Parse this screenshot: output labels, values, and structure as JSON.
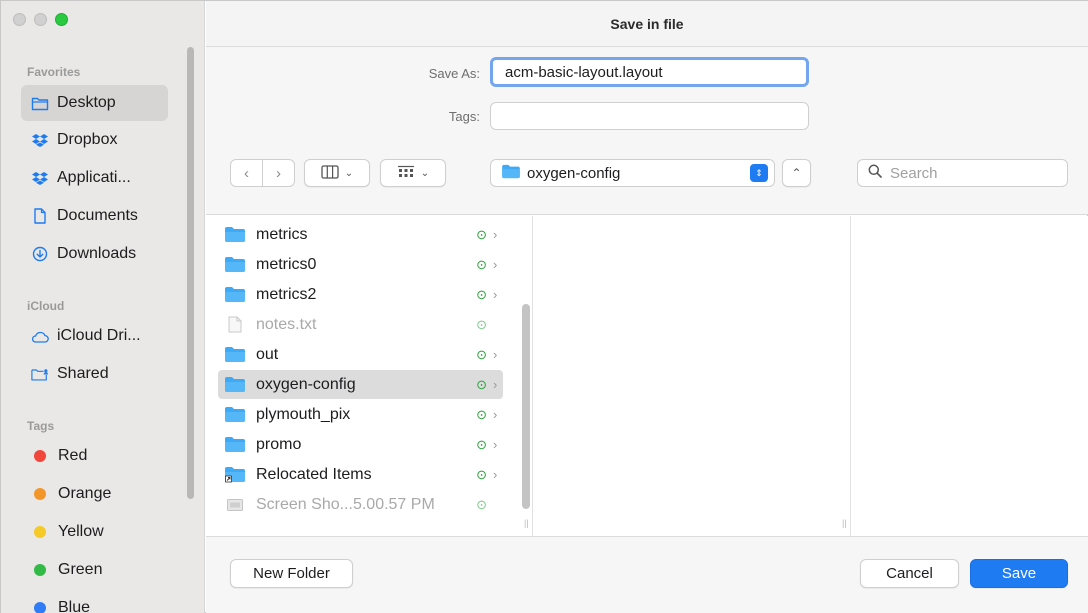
{
  "window": {
    "title": "Save in file"
  },
  "sidebar": {
    "favorites_header": "Favorites",
    "favorites": [
      {
        "label": "Desktop",
        "icon": "desktop-folder-icon",
        "selected": true
      },
      {
        "label": "Dropbox",
        "icon": "dropbox-icon"
      },
      {
        "label": "Applicati...",
        "icon": "dropbox-icon"
      },
      {
        "label": "Documents",
        "icon": "document-icon"
      },
      {
        "label": "Downloads",
        "icon": "download-icon"
      }
    ],
    "icloud_header": "iCloud",
    "icloud": [
      {
        "label": "iCloud Dri...",
        "icon": "cloud-icon"
      },
      {
        "label": "Shared",
        "icon": "shared-folder-icon"
      }
    ],
    "tags_header": "Tags",
    "tags": [
      {
        "label": "Red",
        "color": "#f0463c"
      },
      {
        "label": "Orange",
        "color": "#f3962a"
      },
      {
        "label": "Yellow",
        "color": "#f5c927"
      },
      {
        "label": "Green",
        "color": "#33b946"
      },
      {
        "label": "Blue",
        "color": "#2f7cf6"
      }
    ]
  },
  "form": {
    "save_as_label": "Save As:",
    "save_as_value": "acm-basic-layout.layout",
    "tags_label": "Tags:"
  },
  "toolbar": {
    "location": "oxygen-config",
    "search_placeholder": "Search"
  },
  "files": [
    {
      "name": "metrics",
      "type": "folder"
    },
    {
      "name": "metrics0",
      "type": "folder"
    },
    {
      "name": "metrics2",
      "type": "folder"
    },
    {
      "name": "notes.txt",
      "type": "file",
      "dim": true
    },
    {
      "name": "out",
      "type": "folder"
    },
    {
      "name": "oxygen-config",
      "type": "folder",
      "selected": true
    },
    {
      "name": "plymouth_pix",
      "type": "folder"
    },
    {
      "name": "promo",
      "type": "folder"
    },
    {
      "name": "Relocated Items",
      "type": "alias-folder"
    },
    {
      "name": "Screen Sho...5.00.57 PM",
      "type": "image",
      "dim": true
    }
  ],
  "buttons": {
    "new_folder": "New Folder",
    "cancel": "Cancel",
    "save": "Save"
  },
  "colors": {
    "accent": "#1f7bf2",
    "sync_badge": "#2aa13b",
    "folder": "#3fa9f5"
  }
}
